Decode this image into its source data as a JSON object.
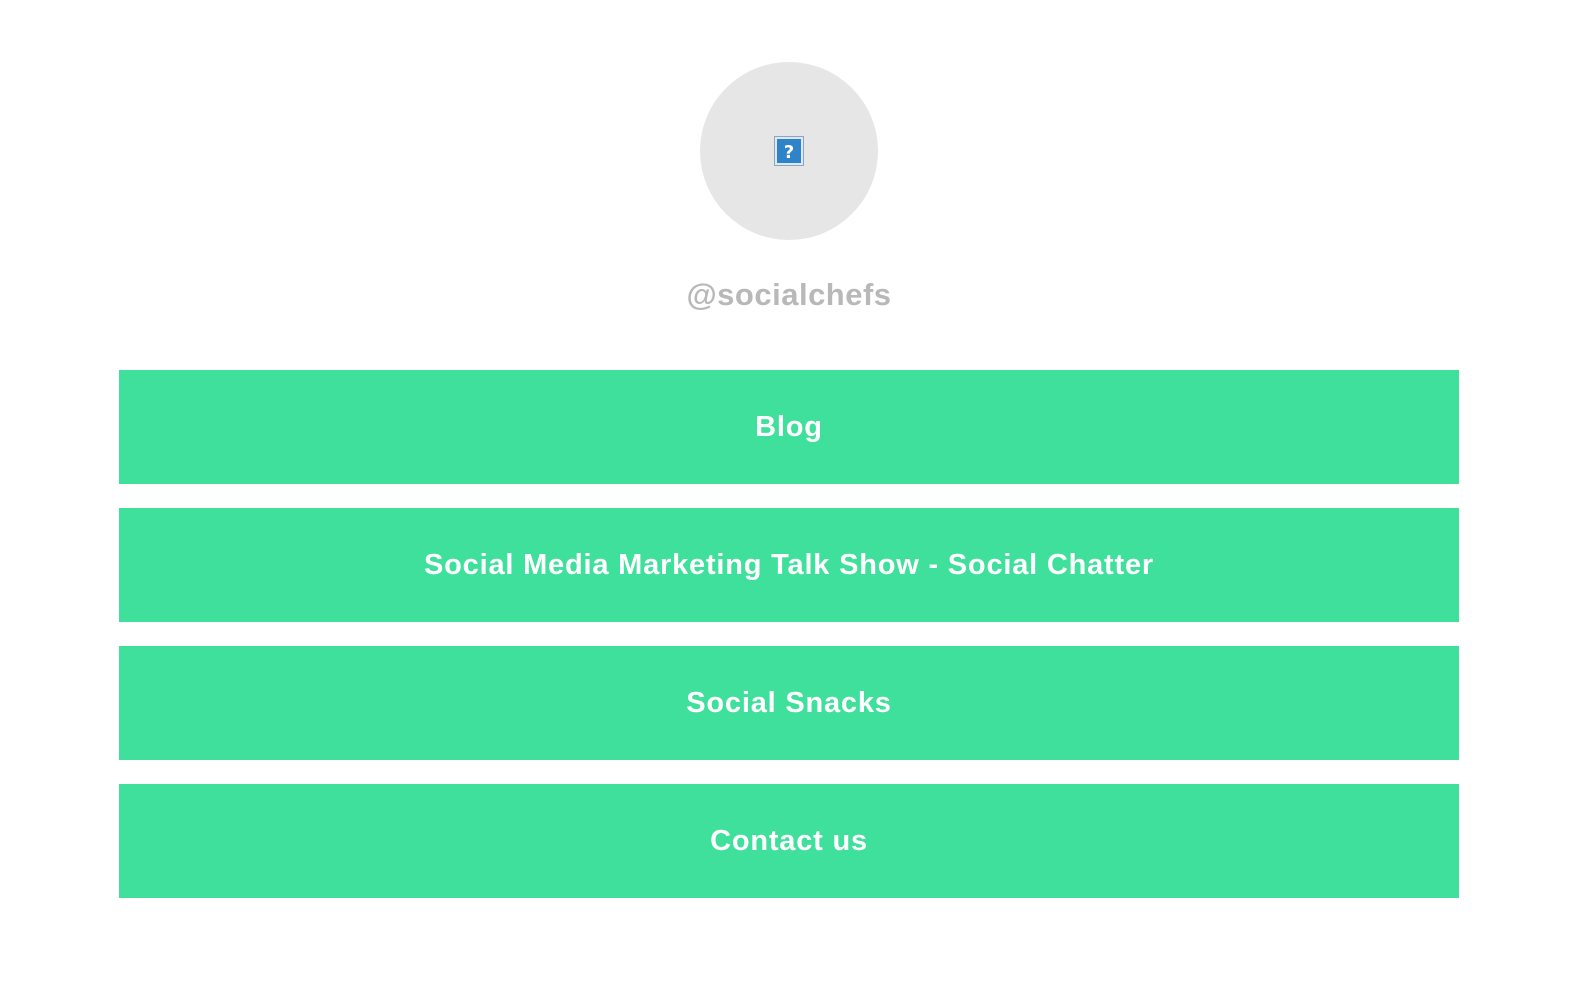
{
  "profile": {
    "avatar_icon": "broken-image-icon",
    "handle": "@socialchefs"
  },
  "links": [
    {
      "label": "Blog"
    },
    {
      "label": "Social Media Marketing Talk Show - Social Chatter"
    },
    {
      "label": "Social Snacks"
    },
    {
      "label": "Contact us"
    }
  ],
  "colors": {
    "button_background": "#3ee09b",
    "button_text": "#ffffff",
    "handle_text": "#b8b8b8",
    "avatar_background": "#e6e6e6",
    "page_background": "#ffffff"
  }
}
